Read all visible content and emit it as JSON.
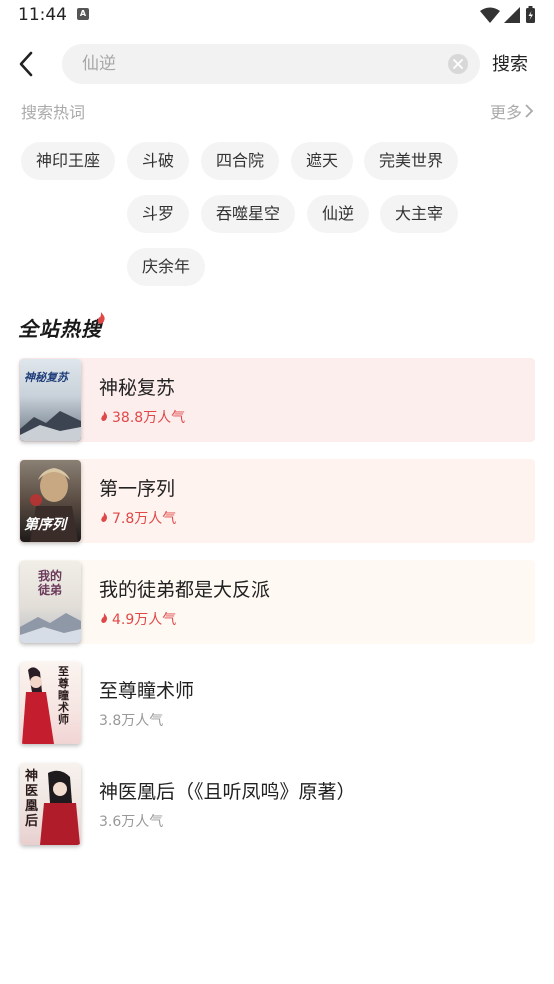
{
  "status_bar": {
    "time": "11:44",
    "notification_icon": "A"
  },
  "header": {
    "search_value": "仙逆",
    "search_button": "搜索"
  },
  "hot_words": {
    "title": "搜索热词",
    "more": "更多",
    "tags": [
      "神印王座",
      "斗破",
      "四合院",
      "遮天",
      "完美世界",
      "斗罗",
      "吞噬星空",
      "仙逆",
      "大主宰",
      "庆余年"
    ]
  },
  "hot_list": {
    "title": "全站热搜",
    "books": [
      {
        "title": "神秘复苏",
        "heat": "38.8万人气",
        "hot": true,
        "cover_text": "神秘复苏",
        "card_color": "#fdeeee"
      },
      {
        "title": "第一序列",
        "heat": "7.8万人气",
        "hot": true,
        "cover_text": "第序列",
        "card_color": "#fef3ef"
      },
      {
        "title": "我的徒弟都是大反派",
        "heat": "4.9万人气",
        "hot": true,
        "cover_text": "我的徒弟",
        "card_color": "#fef9f3"
      },
      {
        "title": "至尊瞳术师",
        "heat": "3.8万人气",
        "hot": false,
        "cover_text": "至尊瞳术师",
        "card_color": "#ffffff"
      },
      {
        "title": "神医凰后（《且听凤鸣》原著）",
        "heat": "3.6万人气",
        "hot": false,
        "cover_text": "神医凰后",
        "card_color": "#ffffff"
      }
    ]
  },
  "colors": {
    "hot_red": "#e04848",
    "muted": "#999999",
    "tag_bg": "#f4f4f4"
  },
  "icons": [
    "back-arrow-icon",
    "clear-icon",
    "chevron-right-icon",
    "flame-icon",
    "wifi-icon",
    "signal-icon",
    "battery-icon"
  ]
}
